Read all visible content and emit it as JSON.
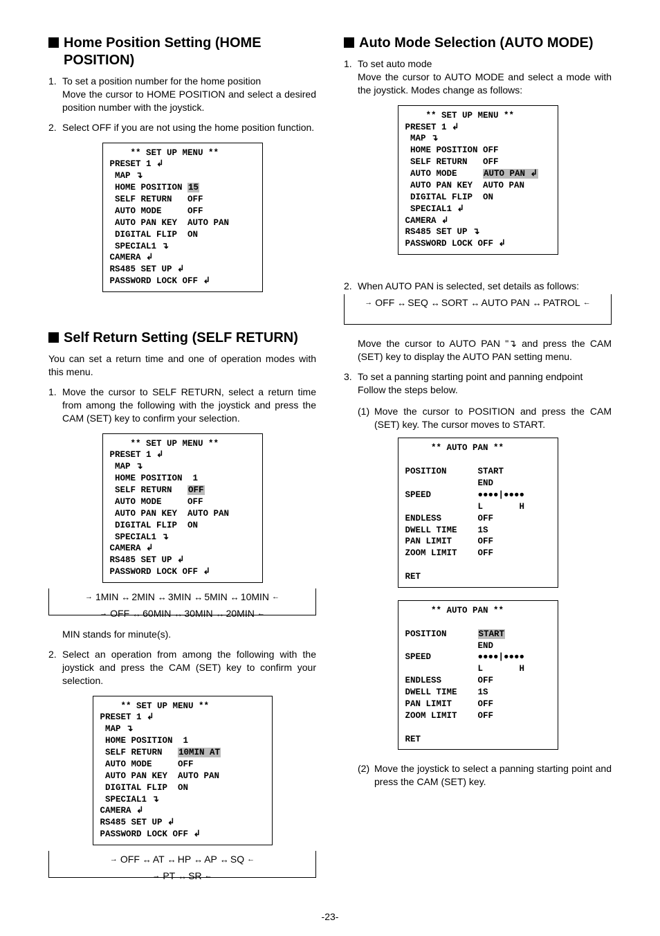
{
  "pageNumber": "-23-",
  "left": {
    "sec1": {
      "title": "Home Position Setting (HOME POSITION)",
      "step1num": "1.",
      "step1a": "To set a position number for the home position",
      "step1b": "Move the cursor to HOME POSITION and select a desired position number with the joystick.",
      "step2num": "2.",
      "step2": "Select OFF if you are not using the home position function.",
      "menu": {
        "l1": "    ** SET UP MENU **",
        "l2": "PRESET 1 ↲",
        "l3": " MAP ↴",
        "l4a": " HOME POSITION ",
        "l4hl": "15",
        "l5": " SELF RETURN   OFF",
        "l6": " AUTO MODE     OFF",
        "l7": " AUTO PAN KEY  AUTO PAN",
        "l8": " DIGITAL FLIP  ON",
        "l9": " SPECIAL1 ↴",
        "l10": "CAMERA ↲",
        "l11": "RS485 SET UP ↲",
        "l12": "PASSWORD LOCK OFF ↲"
      }
    },
    "sec2": {
      "title": "Self Return Setting (SELF RETURN)",
      "intro": "You can set a return time and one of operation modes with this menu.",
      "step1num": "1.",
      "step1": "Move the cursor to SELF RETURN, select a return time from among the following with the joystick and press the CAM (SET) key to confirm your selection.",
      "menu": {
        "l1": "    ** SET UP MENU **",
        "l2": "PRESET 1 ↲",
        "l3": " MAP ↴",
        "l4": " HOME POSITION  1",
        "l5a": " SELF RETURN   ",
        "l5hl": "OFF",
        "l6": " AUTO MODE     OFF",
        "l7": " AUTO PAN KEY  AUTO PAN",
        "l8": " DIGITAL FLIP  ON",
        "l9": " SPECIAL1 ↴",
        "l10": "CAMERA ↲",
        "l11": "RS485 SET UP ↲",
        "l12": "PASSWORD LOCK OFF ↲"
      },
      "cycleTop": [
        "1MIN",
        "2MIN",
        "3MIN",
        "5MIN",
        "10MIN"
      ],
      "cycleBottom": [
        "OFF",
        "60MIN",
        "30MIN",
        "20MIN"
      ],
      "note": "MIN stands for minute(s).",
      "step2num": "2.",
      "step2": "Select an operation from among the following with the joystick and press the CAM (SET) key to confirm your selection.",
      "menu2": {
        "l1": "    ** SET UP MENU **",
        "l2": "PRESET 1 ↲",
        "l3": " MAP ↴",
        "l4": " HOME POSITION  1",
        "l5a": " SELF RETURN   ",
        "l5hl": "10MIN AT",
        "l6": " AUTO MODE     OFF",
        "l7": " AUTO PAN KEY  AUTO PAN",
        "l8": " DIGITAL FLIP  ON",
        "l9": " SPECIAL1 ↴",
        "l10": "CAMERA ↲",
        "l11": "RS485 SET UP ↲",
        "l12": "PASSWORD LOCK OFF ↲"
      },
      "cycle2Top": [
        "OFF",
        "AT",
        "HP",
        "AP",
        "SQ"
      ],
      "cycle2Bottom": [
        "PT",
        "SR"
      ]
    }
  },
  "right": {
    "sec1": {
      "title": "Auto Mode Selection (AUTO MODE)",
      "step1num": "1.",
      "step1a": "To set auto mode",
      "step1b": "Move the cursor to AUTO MODE and select a mode with the joystick. Modes change as follows:",
      "menu": {
        "l1": "    ** SET UP MENU **",
        "l2": "PRESET 1 ↲",
        "l3": " MAP ↴",
        "l4": " HOME POSITION OFF",
        "l5": " SELF RETURN   OFF",
        "l6a": " AUTO MODE     ",
        "l6hl": "AUTO PAN ↲",
        "l7": " AUTO PAN KEY  AUTO PAN",
        "l8": " DIGITAL FLIP  ON",
        "l9": " SPECIAL1 ↲",
        "l10": "CAMERA ↲",
        "l11": "RS485 SET UP ↴",
        "l12": "PASSWORD LOCK OFF ↲"
      },
      "step2num": "2.",
      "step2": "When AUTO PAN is selected, set details as follows:",
      "cycle": [
        "OFF",
        "SEQ",
        "SORT",
        "AUTO PAN",
        "PATROL"
      ],
      "afterCycle": "Move the cursor to AUTO PAN \"↴ and press the CAM (SET) key to display the AUTO PAN setting menu.",
      "step3num": "3.",
      "step3a": "To set a panning starting point and panning endpoint",
      "step3b": "Follow the steps below.",
      "sub1num": "(1)",
      "sub1": "Move the cursor to POSITION and press the CAM (SET) key. The cursor moves to START.",
      "apmenu1": {
        "l1": "     ** AUTO PAN **",
        "l2": "",
        "l3": "POSITION      START",
        "l4": "              END",
        "l5": "SPEED         ●●●●|●●●●",
        "l6": "              L       H",
        "l7": "ENDLESS       OFF",
        "l8": "DWELL TIME    1S",
        "l9": "PAN LIMIT     OFF",
        "l10": "ZOOM LIMIT    OFF",
        "l11": "",
        "l12": "RET"
      },
      "apmenu2": {
        "l1": "     ** AUTO PAN **",
        "l2": "",
        "l3a": "POSITION      ",
        "l3hl": "START",
        "l4": "              END",
        "l5": "SPEED         ●●●●|●●●●",
        "l6": "              L       H",
        "l7": "ENDLESS       OFF",
        "l8": "DWELL TIME    1S",
        "l9": "PAN LIMIT     OFF",
        "l10": "ZOOM LIMIT    OFF",
        "l11": "",
        "l12": "RET"
      },
      "sub2num": "(2)",
      "sub2": "Move the joystick to select a panning starting point and press the CAM (SET) key."
    }
  }
}
